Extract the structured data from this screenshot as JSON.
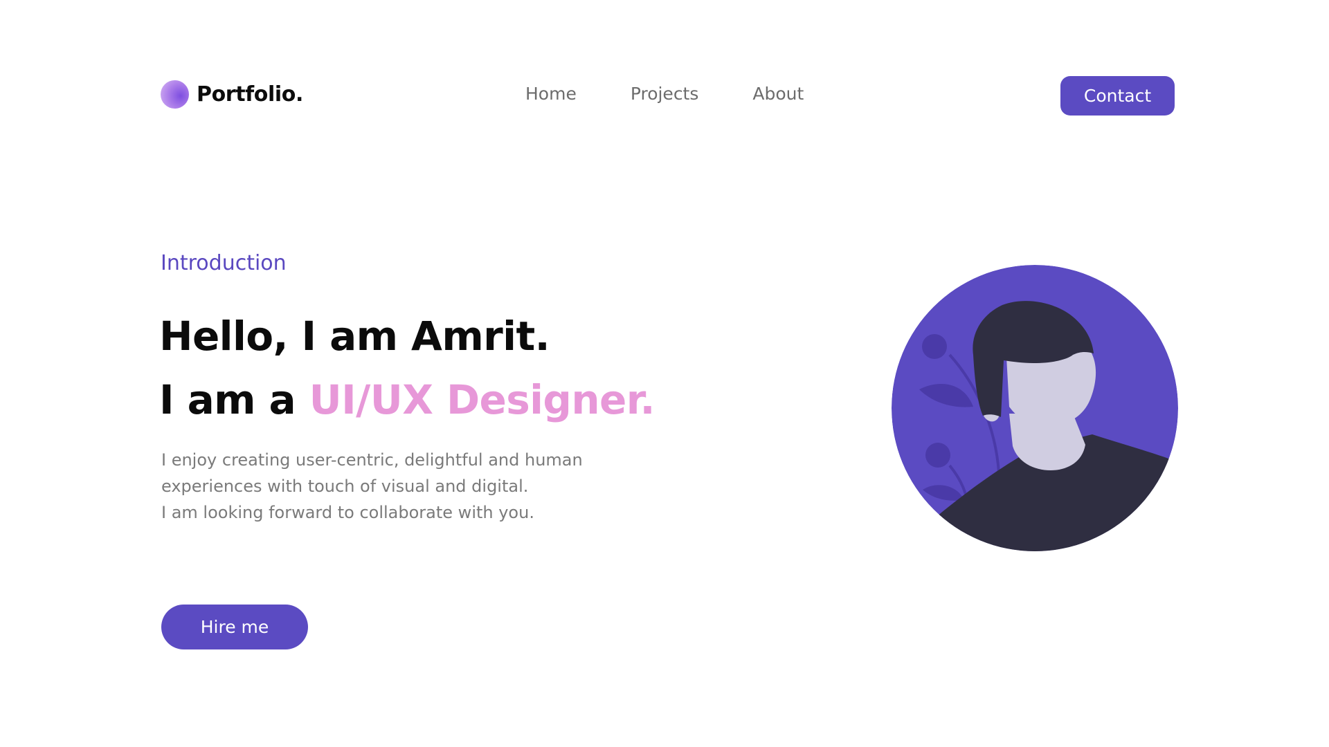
{
  "header": {
    "logo_text": "Portfolio.",
    "nav": [
      "Home",
      "Projects",
      "About"
    ],
    "contact_label": "Contact"
  },
  "hero": {
    "eyebrow": "Introduction",
    "line1": "Hello, I am Amrit.",
    "line2_prefix": "I am a ",
    "line2_accent": "UI/UX Designer.",
    "description": [
      "I enjoy creating user-centric, delightful and human",
      "experiences with touch of visual and digital.",
      "I am looking forward to collaborate with you."
    ],
    "cta_label": "Hire me"
  },
  "colors": {
    "brand": "#5b4bc2",
    "accent_pink": "#e798d8",
    "dark": "#2f2e41",
    "skin": "#d0cde1"
  },
  "avatar_icon": "person-illustration-icon"
}
